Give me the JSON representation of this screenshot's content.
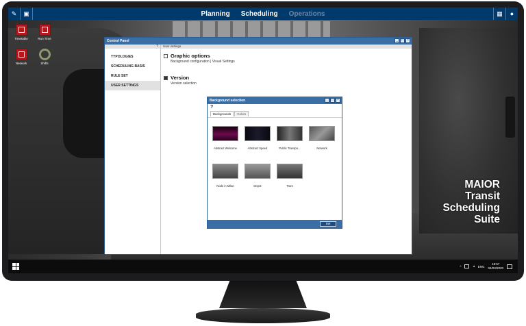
{
  "topbar": {
    "nav": [
      "Planning",
      "Scheduling",
      "Operations"
    ],
    "left_icons": [
      "pen-icon",
      "chat-icon"
    ],
    "right_icons": [
      "grid-icon",
      "user-icon"
    ]
  },
  "desktop_icons": [
    {
      "label": "Timetable",
      "icon": "timetable-icon"
    },
    {
      "label": "Run Time",
      "icon": "run-time-icon"
    },
    {
      "label": "Network",
      "icon": "network-icon"
    },
    {
      "label": "Shifts",
      "icon": "shifts-icon"
    }
  ],
  "control_panel": {
    "title": "Control Panel",
    "sidebar_help": "?",
    "sidebar_items": [
      "TYPOLOGIES",
      "SCHEDULING BASIS",
      "RULE SET",
      "USER SETTINGS"
    ],
    "main_header": "User settings",
    "sections": [
      {
        "title": "Graphic options",
        "subtitle": "Background configuration | Visual Settings"
      },
      {
        "title": "Version",
        "subtitle": "Version selection"
      }
    ]
  },
  "background_selection": {
    "title": "Background selection",
    "help": "?",
    "tabs": [
      "Backgrounds",
      "Colors"
    ],
    "thumbnails": [
      {
        "label": "Abstract Welcome"
      },
      {
        "label": "Abstract Speed"
      },
      {
        "label": "Public Transpo..."
      },
      {
        "label": "Network"
      },
      {
        "label": "Node in Milan"
      },
      {
        "label": "Depot"
      },
      {
        "label": "Tram"
      }
    ],
    "set_label": "Set"
  },
  "brand": {
    "lines": [
      "MAIOR",
      "Transit",
      "Scheduling",
      "Suite"
    ]
  },
  "taskbar": {
    "lang": "ENG",
    "time": "18:57",
    "date": "04/03/2020"
  }
}
